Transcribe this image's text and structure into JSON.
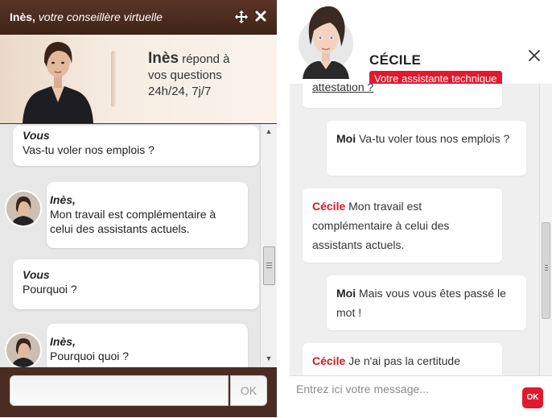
{
  "ines": {
    "title_name": "Inès,",
    "title_role": "votre conseillère virtuelle",
    "banner": {
      "name": "Inès",
      "line1_rest": "répond à",
      "line2": "vos questions",
      "line3": "24h/24, 7j/7"
    },
    "messages": [
      {
        "sender": "Vous",
        "lines": [
          "Vas-tu voler nos emplois ?"
        ]
      },
      {
        "sender": "Inès,",
        "lines": [
          "Mon travail est complémentaire à",
          "celui des assistants actuels."
        ]
      },
      {
        "sender": "Vous",
        "lines": [
          "Pourquoi ?"
        ]
      },
      {
        "sender": "Inès,",
        "lines": [
          "Pourquoi quoi ?"
        ]
      }
    ],
    "ok_label": "OK"
  },
  "cecile": {
    "name": "CÉCILE",
    "badge": "Votre assistante technique",
    "messages": [
      {
        "sender": "",
        "text": "attestation ?"
      },
      {
        "sender": "Moi",
        "text": "Va-tu voler tous nos emplois ?"
      },
      {
        "sender": "Cécile",
        "text": "Mon travail est complémentaire à celui des assistants actuels."
      },
      {
        "sender": "Moi",
        "text": "Mais vous vous êtes passé le mot !"
      },
      {
        "sender": "Cécile",
        "text": "Je n'ai pas la certitude"
      }
    ],
    "input_placeholder": "Entrez ici votre message...",
    "ok_label": "OK"
  },
  "colors": {
    "ines_frame": "#4a2c22",
    "cecile_accent": "#e1192d"
  }
}
